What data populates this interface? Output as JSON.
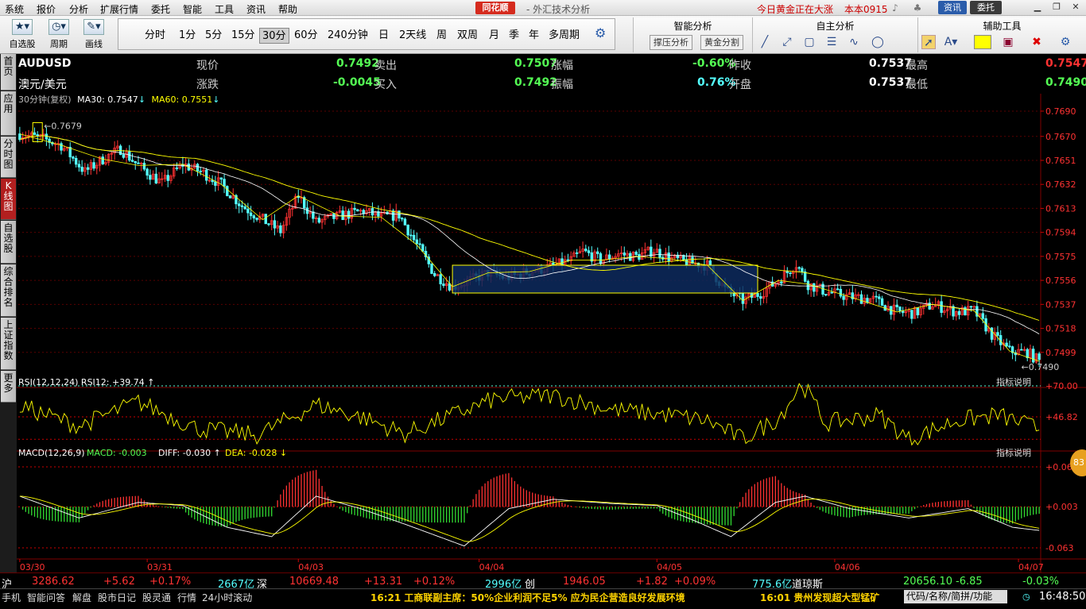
{
  "menu": [
    "系统",
    "报价",
    "分析",
    "扩展行情",
    "委托",
    "智能",
    "工具",
    "资讯",
    "帮助"
  ],
  "window": {
    "brand": "同花顺",
    "title": "外汇技术分析",
    "promo": "今日黄金正在大涨",
    "account": "本本0915",
    "btn_news": "资讯",
    "btn_trade": "委托"
  },
  "toolbar": {
    "self_select": "自选股",
    "cycle": "周期",
    "draw": "画线",
    "periods": [
      "分时",
      "1分",
      "5分",
      "15分",
      "30分",
      "60分",
      "240分钟",
      "日",
      "2天线",
      "周",
      "双周",
      "月",
      "季",
      "年",
      "多周期"
    ],
    "active_period": "30分",
    "smart_title": "智能分析",
    "smart_btn1": "撑压分析",
    "smart_btn2": "黄金分割",
    "self_title": "自主分析",
    "aux_title": "辅助工具"
  },
  "leftnav": [
    "首页",
    "应用",
    "分时图",
    "K线图",
    "自选股",
    "综合排名",
    "上证指数",
    "更多"
  ],
  "quote": {
    "symbol": "AUDUSD",
    "name": "澳元/美元",
    "now_label": "现价",
    "now": "0.7492",
    "sell_label": "卖出",
    "sell": "0.7507",
    "pct_label": "涨幅",
    "pct": "-0.60%",
    "prev_label": "昨收",
    "prev": "0.7537",
    "high_label": "最高",
    "high": "0.7547",
    "chg_label": "涨跌",
    "chg": "-0.0045",
    "buy_label": "买入",
    "buy": "0.7492",
    "amp_label": "振幅",
    "amp": "0.76%",
    "open_label": "开盘",
    "open": "0.7537",
    "low_label": "最低",
    "low": "0.7490"
  },
  "indicators": {
    "main": "30分钟(复权)",
    "ma30": "MA30: 0.7547",
    "ma60": "MA60: 0.7551",
    "rsi": "RSI(12,12,24) RSI12: +39.74",
    "rsi_help": "指标说明",
    "macd": "MACD(12,26,9)",
    "macd_val": "MACD: -0.003",
    "diff": "DIFF: -0.030",
    "dea": "DEA: -0.028",
    "macd_help": "指标说明"
  },
  "chart_data": {
    "type": "candlestick",
    "price_ticks": [
      "0.7690",
      "0.7670",
      "0.7651",
      "0.7632",
      "0.7613",
      "0.7594",
      "0.7575",
      "0.7556",
      "0.7537",
      "0.7518",
      "0.7499"
    ],
    "ylim": [
      0.748,
      0.7695
    ],
    "max_label": "0.7679",
    "min_label": "0.7490",
    "rsi_ticks": [
      "+70.00",
      "+46.82"
    ],
    "macd_ticks": [
      "+0.067",
      "+0.003",
      "-0.063"
    ],
    "dates": [
      "03/30",
      "03/31",
      "04/03",
      "04/04",
      "04/05",
      "04/06",
      "04/07"
    ],
    "close_anchors": [
      [
        0,
        0.7672
      ],
      [
        8,
        0.7668
      ],
      [
        14,
        0.7663
      ],
      [
        22,
        0.7642
      ],
      [
        28,
        0.7652
      ],
      [
        34,
        0.766
      ],
      [
        40,
        0.7647
      ],
      [
        48,
        0.7633
      ],
      [
        55,
        0.7648
      ],
      [
        62,
        0.7641
      ],
      [
        68,
        0.7632
      ],
      [
        75,
        0.7615
      ],
      [
        82,
        0.7604
      ],
      [
        88,
        0.7595
      ],
      [
        94,
        0.7623
      ],
      [
        100,
        0.7602
      ],
      [
        108,
        0.7607
      ],
      [
        116,
        0.7611
      ],
      [
        122,
        0.7606
      ],
      [
        128,
        0.7608
      ],
      [
        134,
        0.7584
      ],
      [
        140,
        0.7561
      ],
      [
        146,
        0.7551
      ],
      [
        152,
        0.7556
      ],
      [
        158,
        0.7562
      ],
      [
        164,
        0.7558
      ],
      [
        172,
        0.7563
      ],
      [
        180,
        0.7567
      ],
      [
        186,
        0.7572
      ],
      [
        190,
        0.7579
      ],
      [
        196,
        0.7572
      ],
      [
        202,
        0.7577
      ],
      [
        208,
        0.7575
      ],
      [
        214,
        0.758
      ],
      [
        220,
        0.7573
      ],
      [
        226,
        0.757
      ],
      [
        232,
        0.7568
      ],
      [
        238,
        0.7549
      ],
      [
        244,
        0.754
      ],
      [
        250,
        0.7546
      ],
      [
        256,
        0.7556
      ],
      [
        262,
        0.7569
      ],
      [
        266,
        0.7553
      ],
      [
        272,
        0.7547
      ],
      [
        280,
        0.7543
      ],
      [
        288,
        0.7541
      ],
      [
        296,
        0.7531
      ],
      [
        302,
        0.753
      ],
      [
        308,
        0.7537
      ],
      [
        316,
        0.7531
      ],
      [
        322,
        0.7532
      ],
      [
        328,
        0.7513
      ],
      [
        334,
        0.75
      ],
      [
        340,
        0.7499
      ],
      [
        344,
        0.7492
      ]
    ],
    "candle_count": 345,
    "pattern_box": {
      "x0": 146,
      "x1": 249,
      "p_top": 0.7568,
      "p_bottom": 0.7546
    },
    "rsi_anchors": [
      [
        0,
        55
      ],
      [
        20,
        40
      ],
      [
        40,
        58
      ],
      [
        60,
        38
      ],
      [
        80,
        33
      ],
      [
        100,
        56
      ],
      [
        116,
        46
      ],
      [
        130,
        34
      ],
      [
        146,
        48
      ],
      [
        160,
        60
      ],
      [
        180,
        63
      ],
      [
        200,
        52
      ],
      [
        220,
        48
      ],
      [
        232,
        44
      ],
      [
        244,
        30
      ],
      [
        256,
        46
      ],
      [
        264,
        72
      ],
      [
        272,
        42
      ],
      [
        290,
        48
      ],
      [
        300,
        30
      ],
      [
        316,
        44
      ],
      [
        330,
        48
      ],
      [
        344,
        38
      ]
    ],
    "macd_anchors": [
      [
        0,
        0.02
      ],
      [
        20,
        -0.015
      ],
      [
        40,
        0.01
      ],
      [
        55,
        0.005
      ],
      [
        70,
        -0.03
      ],
      [
        85,
        -0.045
      ],
      [
        100,
        0.02
      ],
      [
        115,
        0.0
      ],
      [
        130,
        -0.025
      ],
      [
        150,
        -0.06
      ],
      [
        165,
        0.0
      ],
      [
        180,
        0.015
      ],
      [
        200,
        0.008
      ],
      [
        215,
        0.005
      ],
      [
        228,
        -0.02
      ],
      [
        240,
        -0.045
      ],
      [
        255,
        0.01
      ],
      [
        265,
        0.02
      ],
      [
        280,
        0.0
      ],
      [
        300,
        -0.015
      ],
      [
        320,
        0.0
      ],
      [
        335,
        -0.03
      ],
      [
        344,
        -0.035
      ]
    ]
  },
  "status": {
    "sh_label": "沪",
    "sh_val": "3286.62",
    "sh_chg": "+5.62",
    "sh_pct": "+0.17%",
    "sh_amt": "2667亿",
    "sz_label": "深",
    "sz_val": "10669.48",
    "sz_chg": "+13.31",
    "sz_pct": "+0.12%",
    "sz_amt": "2996亿",
    "cy_label": "创",
    "cy_val": "1946.05",
    "cy_chg": "+1.82",
    "cy_pct": "+0.09%",
    "cy_amt": "775.6亿",
    "dj_label": "道琼斯",
    "dj_val": "20656.10",
    "dj_chg": "-6.85",
    "dj_pct": "-0.03%"
  },
  "bottom": {
    "tabs": [
      "手机",
      "智能问答",
      "解盘",
      "股市日记",
      "股灵通",
      "行情",
      "24小时滚动"
    ],
    "news1": "16:21 工商联副主席：50%企业利润不足5% 应为民企营造良好发展环境",
    "news2": "16:01 贵州发现超大型锰矿",
    "search": "代码/名称/简拼/功能",
    "clock": "16:48:50",
    "badge": "83"
  },
  "colors": {
    "up": "#ff3232",
    "down": "#54ffff",
    "ma": "#ffff00",
    "diff": "#ffffff",
    "box": "#0d2a5e"
  }
}
